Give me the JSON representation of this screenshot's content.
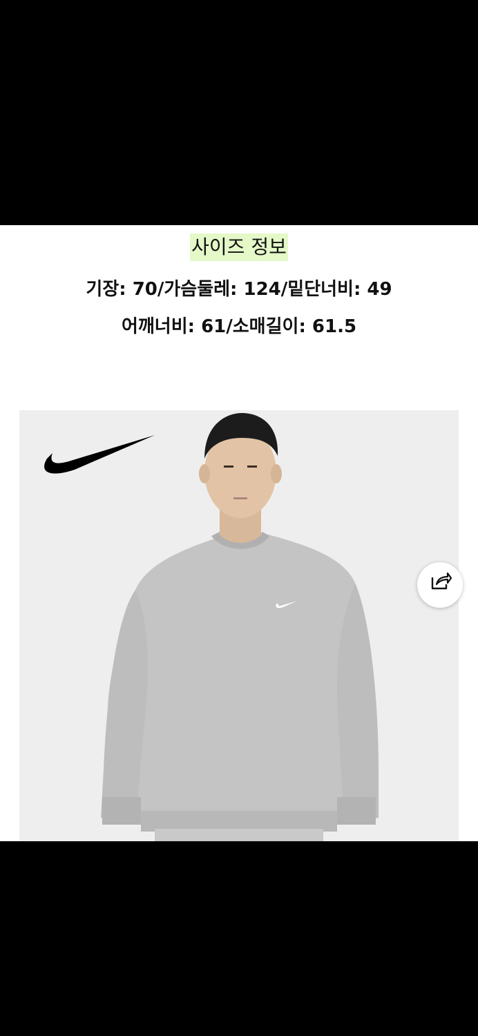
{
  "size_info": {
    "title": "사이즈 정보",
    "line1": "기장: 70/가슴둘레: 124/밑단너비: 49",
    "line2": "어깨너비: 61/소매길이: 61.5"
  },
  "product_image": {
    "brand_logo_icon": "nike-swoosh-icon",
    "subject": "gray crewneck sweatshirt"
  },
  "share": {
    "icon": "share-icon"
  },
  "colors": {
    "title_highlight": "#e4f8c8",
    "background": "#ffffff",
    "letterbox": "#000000"
  }
}
